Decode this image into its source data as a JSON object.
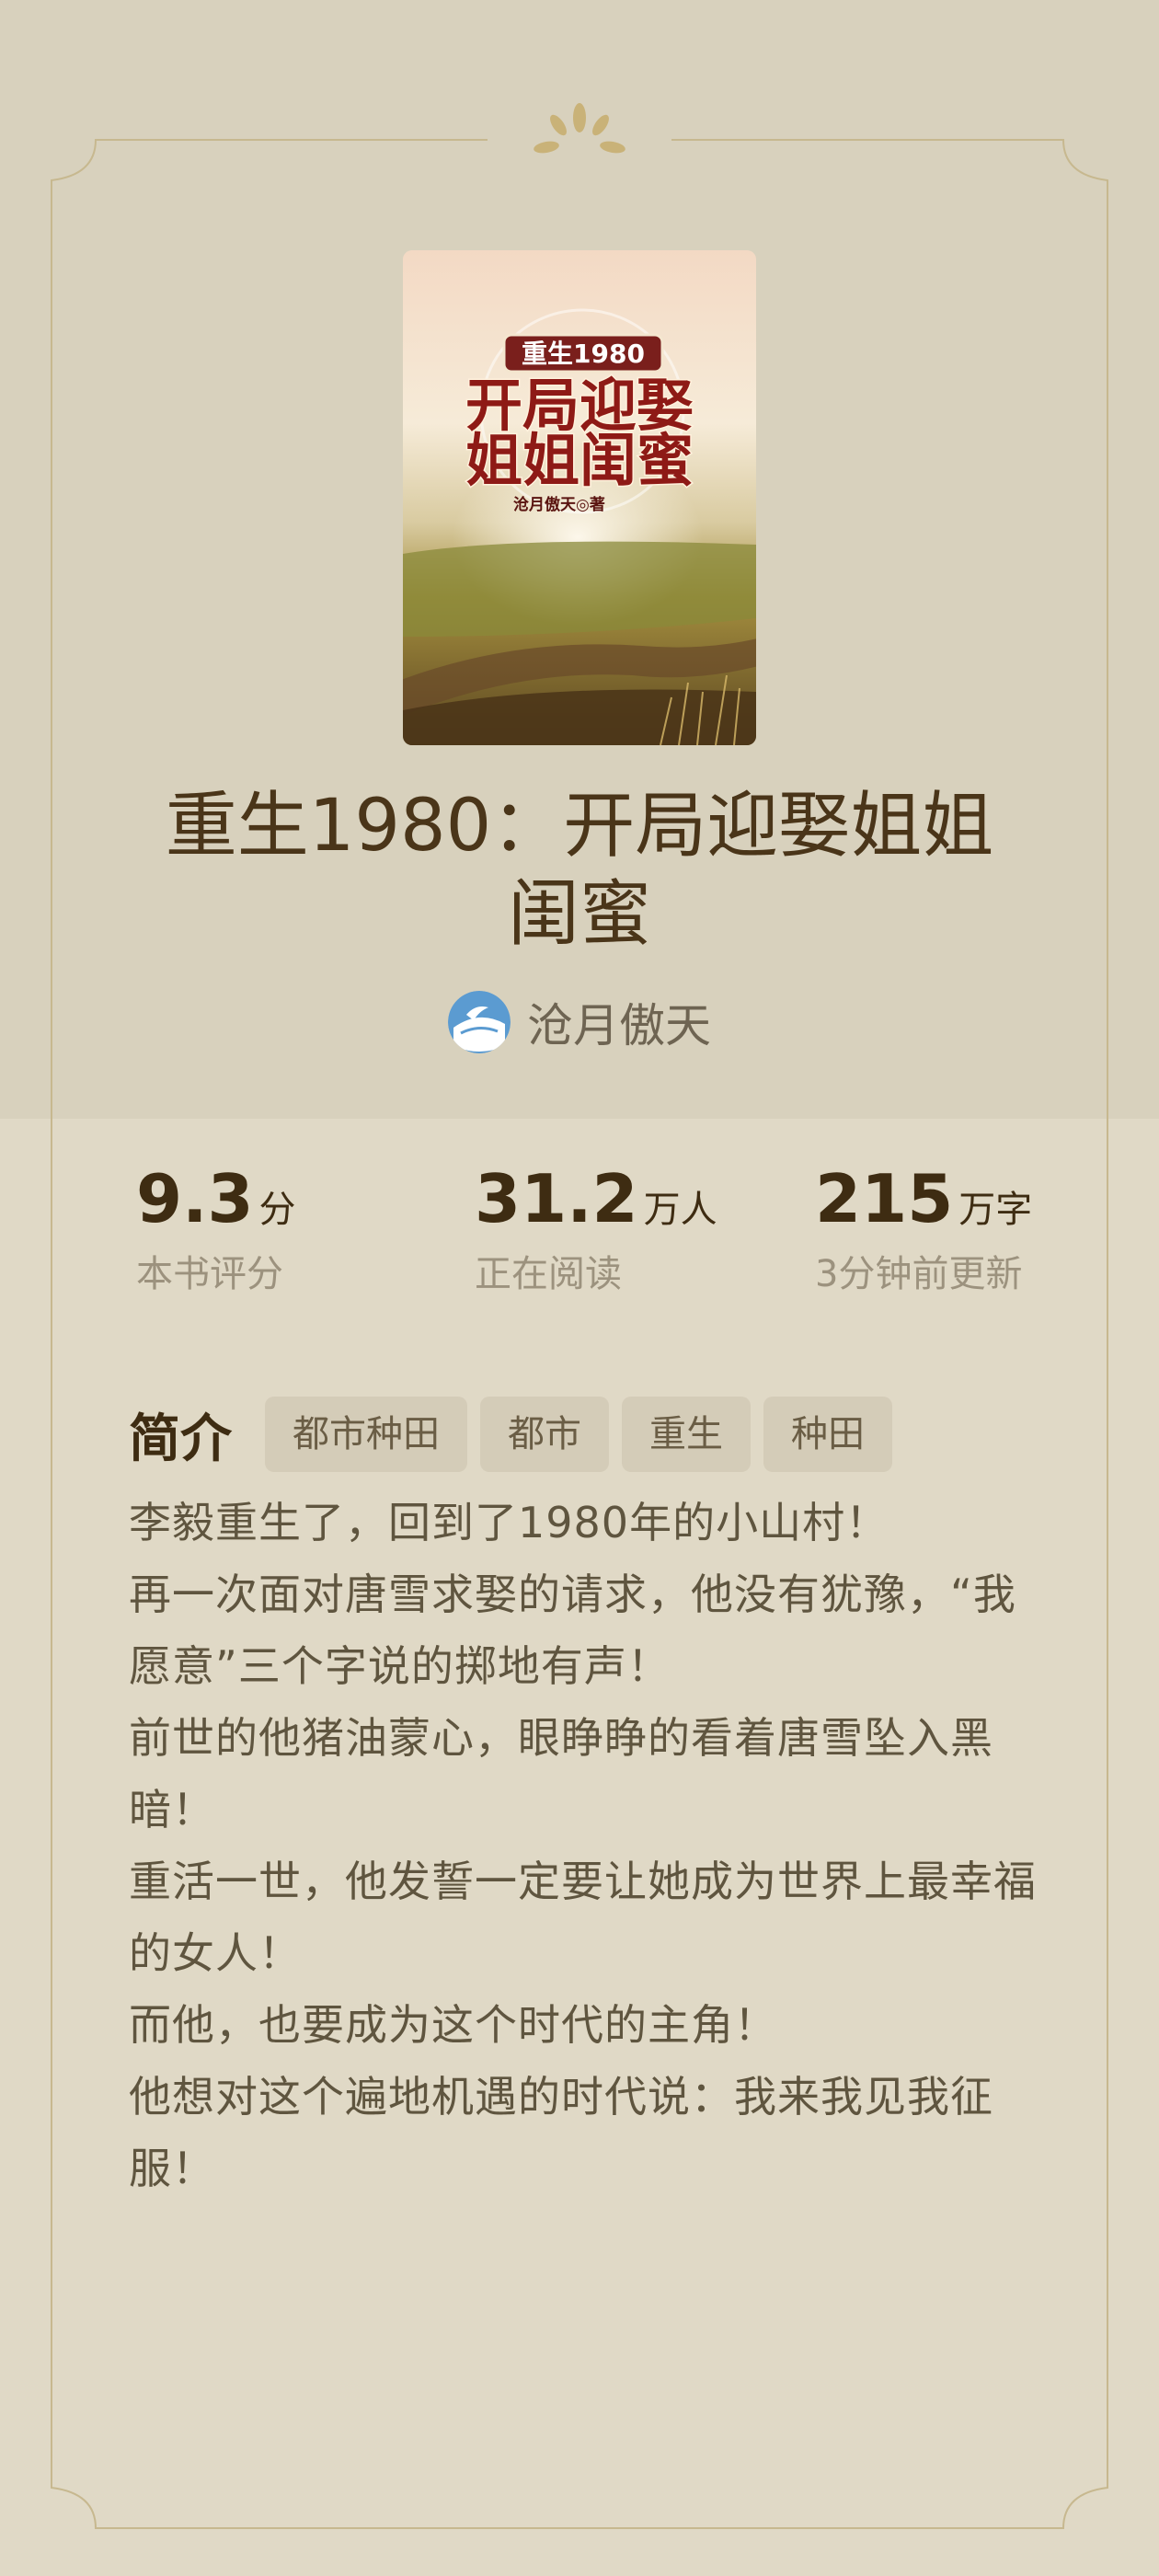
{
  "book": {
    "title": "重生1980：开局迎娶姐姐闺蜜",
    "author": "沧月傲天",
    "cover": {
      "series_text": "重生1980",
      "title_line1": "开局迎娶",
      "title_line2": "姐姐闺蜜",
      "author_text": "沧月傲天◎著"
    }
  },
  "stats": [
    {
      "value": "9.3",
      "unit": "分",
      "label": "本书评分"
    },
    {
      "value": "31.2",
      "unit": "万人",
      "label": "正在阅读"
    },
    {
      "value": "215",
      "unit": "万字",
      "label": "3分钟前更新"
    }
  ],
  "intro": {
    "heading": "简介",
    "tags": [
      "都市种田",
      "都市",
      "重生",
      "种田"
    ],
    "paragraphs": [
      "李毅重生了，回到了1980年的小山村！",
      "再一次面对唐雪求娶的请求，他没有犹豫，“我愿意”三个字说的掷地有声！",
      "前世的他猪油蒙心，眼睁睁的看着唐雪坠入黑暗！",
      "重活一世，他发誓一定要让她成为世界上最幸福的女人！",
      "而他，也要成为这个时代的主角！",
      "他想对这个遍地机遇的时代说：我来我见我征服！"
    ]
  },
  "colors": {
    "accent_gold": "#c9b278",
    "text_dark": "#3e2c12",
    "text_muted": "#9c927e"
  }
}
